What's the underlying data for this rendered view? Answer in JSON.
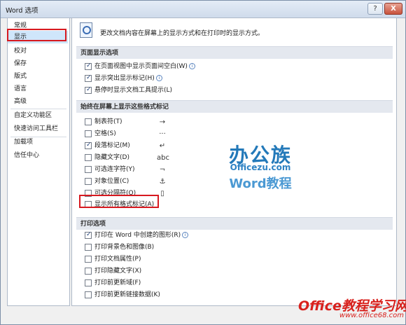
{
  "window": {
    "title": "Word 选项",
    "help_label": "?",
    "close_label": "X"
  },
  "sidebar": {
    "items": [
      {
        "label": "常规"
      },
      {
        "label": "显示"
      },
      {
        "label": "校对"
      },
      {
        "label": "保存"
      },
      {
        "label": "版式"
      },
      {
        "label": "语言"
      },
      {
        "label": "高级"
      },
      {
        "label": "自定义功能区"
      },
      {
        "label": "快速访问工具栏"
      },
      {
        "label": "加载项"
      },
      {
        "label": "信任中心"
      }
    ],
    "selected": "显示"
  },
  "content": {
    "intro": "更改文档内容在屏幕上的显示方式和在打印时的显示方式。",
    "page_display": {
      "title": "页面显示选项",
      "options": [
        {
          "label": "在页面视图中显示页面间空白(W)",
          "checked": true,
          "info": true
        },
        {
          "label": "显示突出显示标记(H)",
          "checked": true,
          "info": true
        },
        {
          "label": "悬停时显示文档工具提示(L)",
          "checked": true,
          "info": false
        }
      ]
    },
    "format_marks": {
      "title": "始终在屏幕上显示这些格式标记",
      "options": [
        {
          "label": "制表符(T)",
          "checked": false,
          "symbol": "→"
        },
        {
          "label": "空格(S)",
          "checked": false,
          "symbol": "···"
        },
        {
          "label": "段落标记(M)",
          "checked": true,
          "symbol": "↵"
        },
        {
          "label": "隐藏文字(D)",
          "checked": false,
          "symbol": "abc"
        },
        {
          "label": "可选连字符(Y)",
          "checked": false,
          "symbol": "¬"
        },
        {
          "label": "对象位置(C)",
          "checked": false,
          "symbol": "⚓"
        },
        {
          "label": "可选分隔符(O)",
          "checked": false,
          "symbol": "▯"
        },
        {
          "label": "显示所有格式标记(A)",
          "checked": false,
          "symbol": ""
        }
      ]
    },
    "print": {
      "title": "打印选项",
      "options": [
        {
          "label": "打印在 Word 中创建的图形(R)",
          "checked": true,
          "info": true
        },
        {
          "label": "打印背景色和图像(B)",
          "checked": false,
          "info": false
        },
        {
          "label": "打印文档属性(P)",
          "checked": false,
          "info": false
        },
        {
          "label": "打印隐藏文字(X)",
          "checked": false,
          "info": false
        },
        {
          "label": "打印前更新域(F)",
          "checked": false,
          "info": false
        },
        {
          "label": "打印前更新链接数据(K)",
          "checked": false,
          "info": false
        }
      ]
    }
  },
  "branding": {
    "logo_cn": "办公族",
    "logo_url": "Officezu.com",
    "logo_word": "Word教程",
    "watermark_cn": "Office教程学习网",
    "watermark_url": "www.office68.com"
  },
  "colors": {
    "highlight_red": "#d71920",
    "logo_blue": "#2379b9",
    "watermark_red": "#d8211d"
  }
}
